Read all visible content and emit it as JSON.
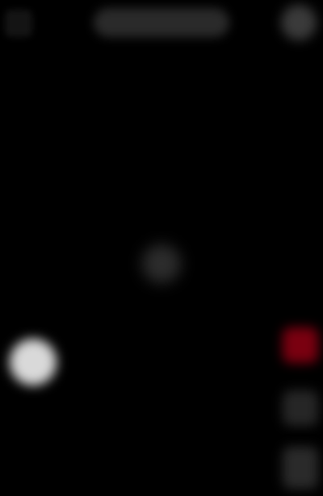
{
  "header": {
    "title": "",
    "back_icon": "back-icon",
    "menu_icon": "more-icon"
  },
  "player": {
    "loading_icon": "loading-spinner-icon"
  },
  "controls": {
    "record_icon": "record-icon",
    "side_actions": [
      {
        "icon": "like-icon",
        "color": "#7a0010"
      },
      {
        "icon": "comment-icon",
        "color": "#262626"
      },
      {
        "icon": "share-icon",
        "color": "#2a2a2a"
      }
    ]
  },
  "colors": {
    "background": "#000000",
    "accent": "#7a0010"
  }
}
